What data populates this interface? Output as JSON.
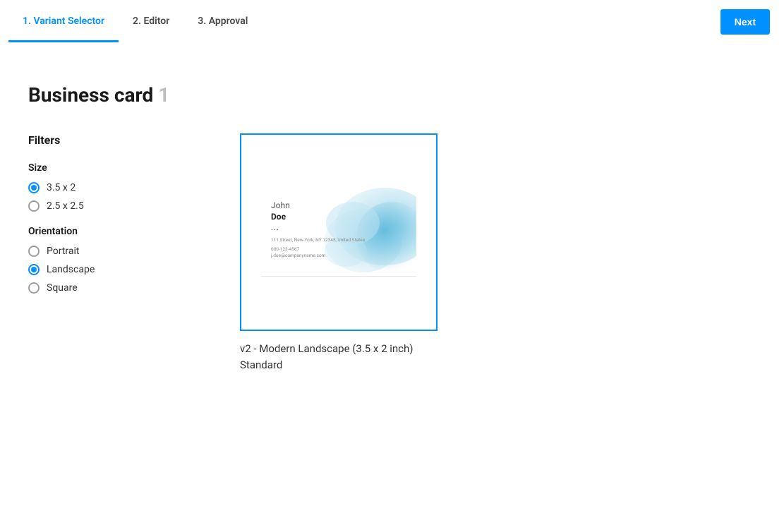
{
  "tabs": [
    {
      "label": "1. Variant Selector",
      "active": true
    },
    {
      "label": "2. Editor",
      "active": false
    },
    {
      "label": "3. Approval",
      "active": false
    }
  ],
  "next_button": "Next",
  "title": "Business card",
  "title_count": "1",
  "filters": {
    "heading": "Filters",
    "groups": [
      {
        "label": "Size",
        "options": [
          {
            "label": "3.5 x 2",
            "checked": true
          },
          {
            "label": "2.5 x 2.5",
            "checked": false
          }
        ]
      },
      {
        "label": "Orientation",
        "options": [
          {
            "label": "Portrait",
            "checked": false
          },
          {
            "label": "Landscape",
            "checked": true
          },
          {
            "label": "Square",
            "checked": false
          }
        ]
      }
    ]
  },
  "card": {
    "label_line1": "v2 - Modern Landscape (3.5 x 2 inch)",
    "label_line2": "Standard",
    "sample": {
      "first_name": "John",
      "last_name": "Doe",
      "dots": "...",
      "address": "111 Street, New-York, NY 12345, United States",
      "phone": "000-123-4567",
      "email": "j.doe@companyname.com"
    }
  },
  "colors": {
    "accent": "#0090ff",
    "watercolor_light": "#bfe4f2",
    "watercolor_mid": "#8fd0e8",
    "watercolor_dark": "#5ab8db"
  }
}
